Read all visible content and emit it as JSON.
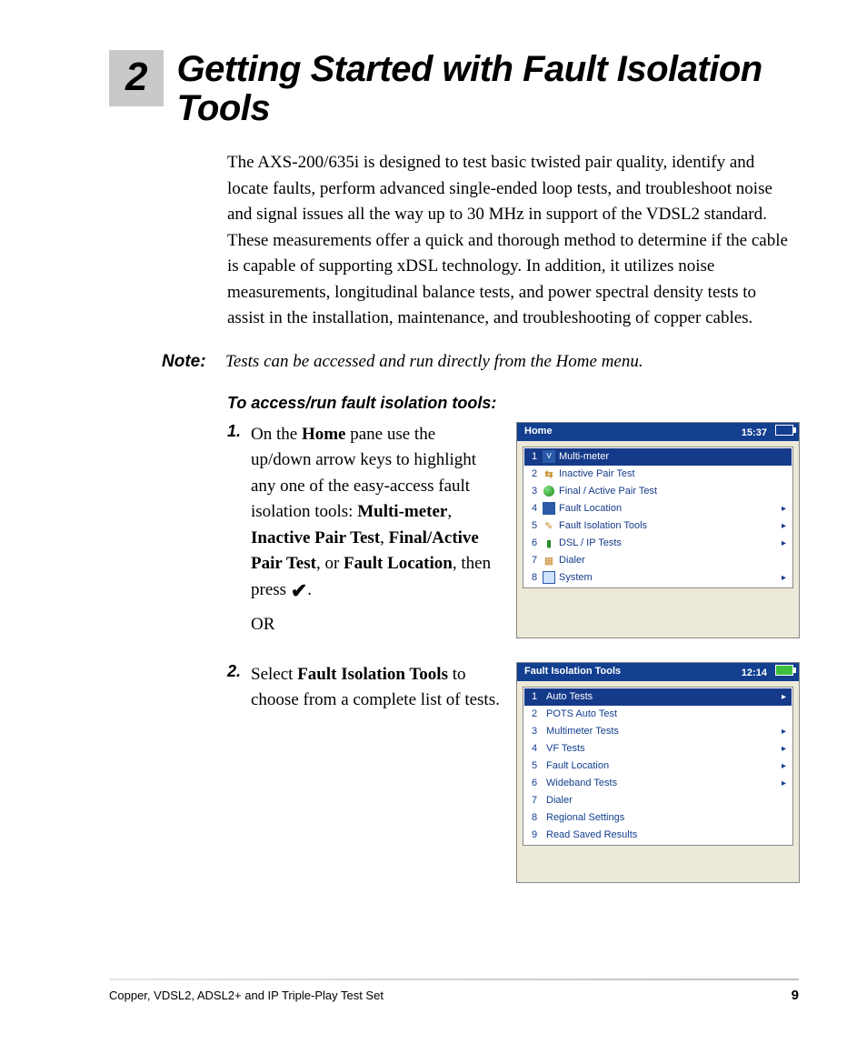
{
  "chapter": {
    "number": "2",
    "title": "Getting Started with Fault Isolation Tools"
  },
  "intro": "The AXS-200/635i is designed to test basic twisted pair quality, identify and locate faults, perform advanced single-ended loop tests, and troubleshoot noise and signal issues all the way up to 30 MHz in support of the VDSL2 standard. These measurements offer a quick and thorough method to determine if the cable is capable of supporting xDSL technology. In addition, it utilizes noise measurements, longitudinal balance tests, and power spectral density tests to assist in the installation, maintenance, and troubleshooting of copper cables.",
  "note": {
    "label": "Note:",
    "text": "Tests can be accessed and run directly from the Home menu."
  },
  "subhead": "To access/run fault isolation tools:",
  "steps": {
    "1": {
      "num": "1.",
      "pre": "On the ",
      "home": "Home",
      "mid1": " pane use the up/down arrow keys to highlight any one of the easy-access fault isolation tools: ",
      "t1": "Multi-meter",
      "c1": ", ",
      "t2": "Inactive Pair Test",
      "c2": ", ",
      "t3": "Final/Active Pair Test",
      "c3": ", or ",
      "t4": "Fault Location",
      "post": ", then press ",
      "dot": ".",
      "or": "OR"
    },
    "2": {
      "num": "2.",
      "pre": "Select ",
      "t1": "Fault Isolation Tools",
      "post": " to choose from a complete list of tests."
    }
  },
  "panel1": {
    "title": "Home",
    "time": "15:37",
    "items": [
      {
        "idx": "1",
        "label": "Multi-meter",
        "arrow": "",
        "selected": true
      },
      {
        "idx": "2",
        "label": "Inactive Pair Test",
        "arrow": ""
      },
      {
        "idx": "3",
        "label": "Final / Active Pair Test",
        "arrow": ""
      },
      {
        "idx": "4",
        "label": "Fault Location",
        "arrow": "▸"
      },
      {
        "idx": "5",
        "label": "Fault Isolation Tools",
        "arrow": "▸"
      },
      {
        "idx": "6",
        "label": "DSL / IP Tests",
        "arrow": "▸"
      },
      {
        "idx": "7",
        "label": "Dialer",
        "arrow": ""
      },
      {
        "idx": "8",
        "label": "System",
        "arrow": "▸"
      }
    ]
  },
  "panel2": {
    "title": "Fault Isolation Tools",
    "time": "12:14",
    "items": [
      {
        "idx": "1",
        "label": "Auto Tests",
        "arrow": "▸",
        "selected": true
      },
      {
        "idx": "2",
        "label": "POTS Auto Test",
        "arrow": ""
      },
      {
        "idx": "3",
        "label": "Multimeter Tests",
        "arrow": "▸"
      },
      {
        "idx": "4",
        "label": "VF Tests",
        "arrow": "▸"
      },
      {
        "idx": "5",
        "label": "Fault Location",
        "arrow": "▸"
      },
      {
        "idx": "6",
        "label": "Wideband Tests",
        "arrow": "▸"
      },
      {
        "idx": "7",
        "label": "Dialer",
        "arrow": ""
      },
      {
        "idx": "8",
        "label": "Regional Settings",
        "arrow": ""
      },
      {
        "idx": "9",
        "label": "Read Saved Results",
        "arrow": ""
      }
    ]
  },
  "footer": {
    "left": "Copper, VDSL2, ADSL2+ and IP Triple-Play Test Set",
    "page": "9"
  }
}
